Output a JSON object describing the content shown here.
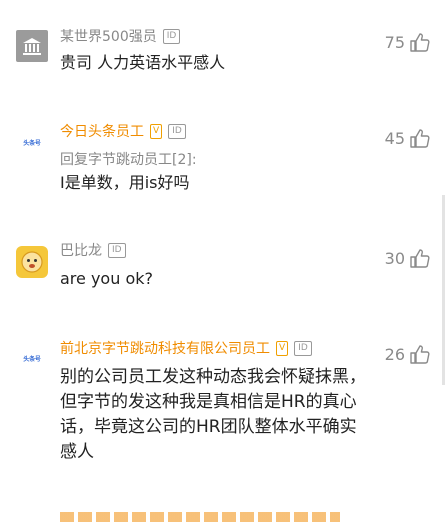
{
  "comments": [
    {
      "author": "某世界500强员",
      "id_badge": "ID",
      "author_color": "#888888",
      "text": "贵司 人力英语水平感人",
      "likes": "75",
      "avatar_icon": "bank-icon"
    },
    {
      "author": "今日头条员工",
      "verified_badge": "V",
      "id_badge": "ID",
      "author_color": "#f08c00",
      "reply_to": "回复字节跳动员工[2]:",
      "text": "I是单数，用is好吗",
      "likes": "45",
      "avatar_icon": "toutiao-logo-icon"
    },
    {
      "author": "巴比龙",
      "id_badge": "ID",
      "author_color": "#888888",
      "text": "are you ok?",
      "likes": "30",
      "avatar_icon": "cartoon-face-icon"
    },
    {
      "author": "前北京字节跳动科技有限公司员工",
      "verified_badge": "V",
      "id_badge": "ID",
      "author_color": "#f08c00",
      "text": "别的公司员工发这种动态我会怀疑抹黑，但字节的发这种我是真相信是HR的真心话，毕竟这公司的HR团队整体水平确实感人",
      "likes": "26",
      "avatar_icon": "toutiao-logo-icon"
    }
  ],
  "logo_text": "头条号"
}
